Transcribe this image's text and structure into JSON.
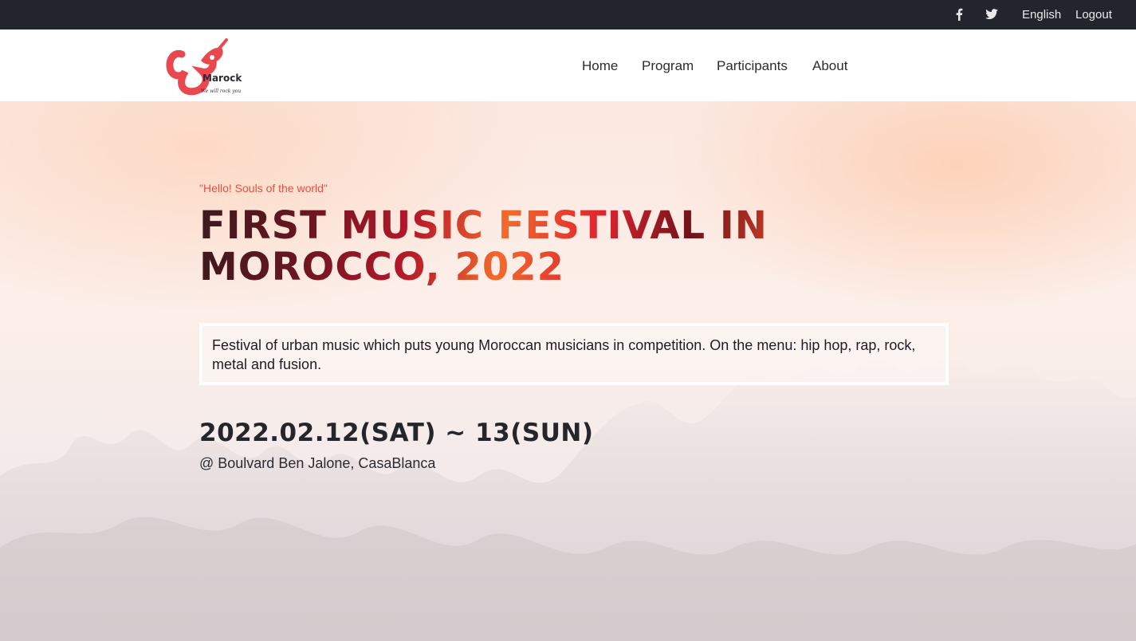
{
  "topbar": {
    "facebook_icon": "facebook-icon",
    "twitter_icon": "twitter-icon",
    "language": "English",
    "logout": "Logout"
  },
  "header": {
    "logo_text": "Marock",
    "logo_tagline": "We will rock you",
    "nav": {
      "home": "Home",
      "program": "Program",
      "participants": "Participants",
      "about": "About"
    }
  },
  "hero": {
    "tagline": "\"Hello! Souls of the world\"",
    "title": "First Music Festival in Morocco, 2022",
    "description": "Festival of urban music which puts young Moroccan musicians in competition. On the menu: hip hop, rap, rock, metal and fusion.",
    "dates": "2022.02.12(SAT) ~ 13(SUN)",
    "venue": "@ Boulvard Ben Jalone, CasaBlanca"
  },
  "colors": {
    "topbar_bg": "#23252d",
    "accent": "#e4513f",
    "title_gradient": [
      "#3a1a1e",
      "#b5182a",
      "#f36a2c",
      "#e0242f"
    ]
  }
}
